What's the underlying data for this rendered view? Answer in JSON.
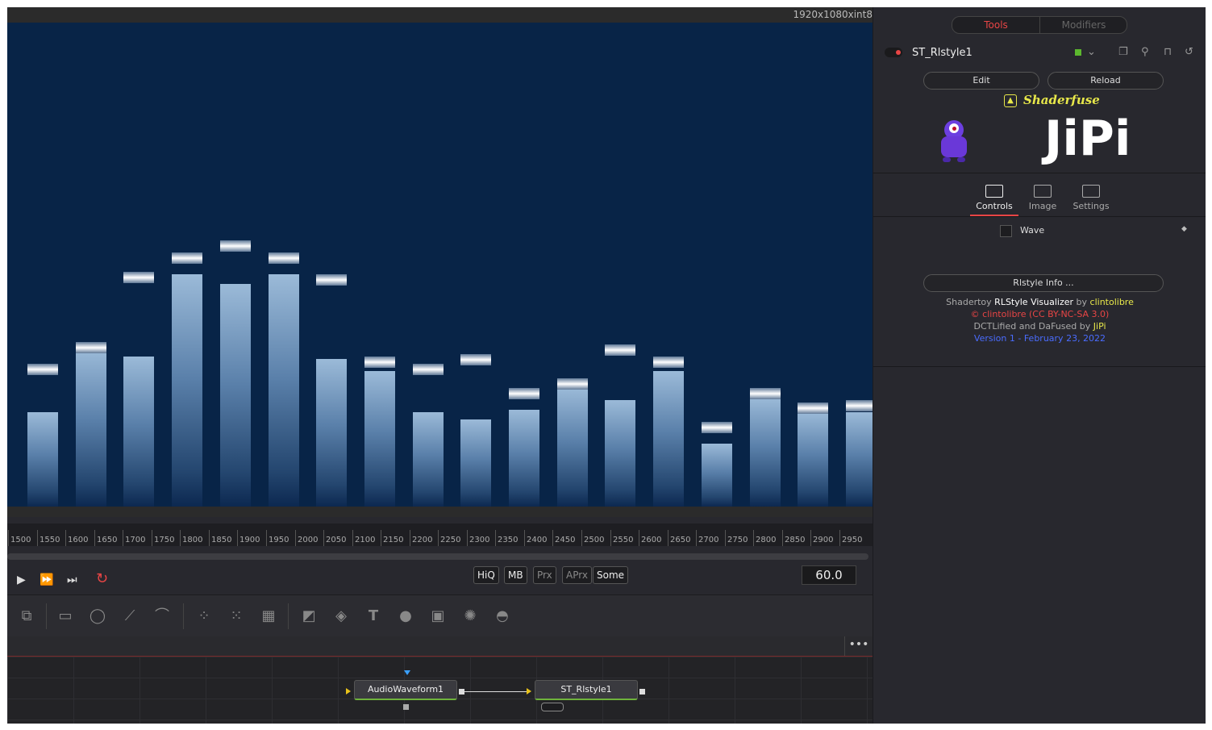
{
  "viewer": {
    "resolution": "1920x1080xint8",
    "bars": [
      {
        "value": 0.39,
        "peak": 0.54
      },
      {
        "value": 0.65,
        "peak": 0.63
      },
      {
        "value": 0.62,
        "peak": 0.92
      },
      {
        "value": 0.96,
        "peak": 1.0
      },
      {
        "value": 0.92,
        "peak": 1.05
      },
      {
        "value": 0.96,
        "peak": 1.0
      },
      {
        "value": 0.61,
        "peak": 0.91
      },
      {
        "value": 0.56,
        "peak": 0.57
      },
      {
        "value": 0.39,
        "peak": 0.54
      },
      {
        "value": 0.36,
        "peak": 0.58
      },
      {
        "value": 0.4,
        "peak": 0.44
      },
      {
        "value": 0.49,
        "peak": 0.48
      },
      {
        "value": 0.44,
        "peak": 0.62
      },
      {
        "value": 0.56,
        "peak": 0.57
      },
      {
        "value": 0.26,
        "peak": 0.3
      },
      {
        "value": 0.45,
        "peak": 0.44
      },
      {
        "value": 0.39,
        "peak": 0.38
      },
      {
        "value": 0.39,
        "peak": 0.39
      }
    ]
  },
  "ruler": {
    "ticks": [
      "1500",
      "1550",
      "1600",
      "1650",
      "1700",
      "1750",
      "1800",
      "1850",
      "1900",
      "1950",
      "2000",
      "2050",
      "2100",
      "2150",
      "2200",
      "2250",
      "2300",
      "2350",
      "2400",
      "2450",
      "2500",
      "2550",
      "2600",
      "2650",
      "2700",
      "2750",
      "2800",
      "2850",
      "2900",
      "2950"
    ]
  },
  "transport": {
    "buttons": [
      "HiQ",
      "MB",
      "Prx",
      "APrx",
      "Some"
    ],
    "frame": "60.0",
    "play": "▶",
    "ffwd": "⏩",
    "end": "⏭",
    "loop": "↻"
  },
  "nodes": {
    "audio": "AudioWaveform1",
    "shader": "ST_Rlstyle1",
    "more": "•••"
  },
  "inspector": {
    "tabs": {
      "tools": "Tools",
      "modifiers": "Modifiers"
    },
    "tool_name": "ST_Rlstyle1",
    "edit": "Edit",
    "reload": "Reload",
    "brand": "Shaderfuse",
    "logo_text": "JiPi",
    "control_tabs": [
      "Controls",
      "Image",
      "Settings"
    ],
    "wave_label": "Wave",
    "info_button": "Rlstyle Info ...",
    "credits": {
      "line1_a": "Shadertoy ",
      "line1_b": "RLStyle Visualizer",
      "line1_c": " by ",
      "line1_d": "clintolibre",
      "line2": "© clintolibre (CC BY-NC-SA 3.0)",
      "line3_a": "DCTLified and DaFused by ",
      "line3_b": "JiPi",
      "line4": "Version 1 - February 23, 2022"
    },
    "colors": {
      "accent_red": "#e84545",
      "green": "#5cb82e",
      "yellow": "#e8e84a",
      "blue": "#4a6cff"
    }
  }
}
